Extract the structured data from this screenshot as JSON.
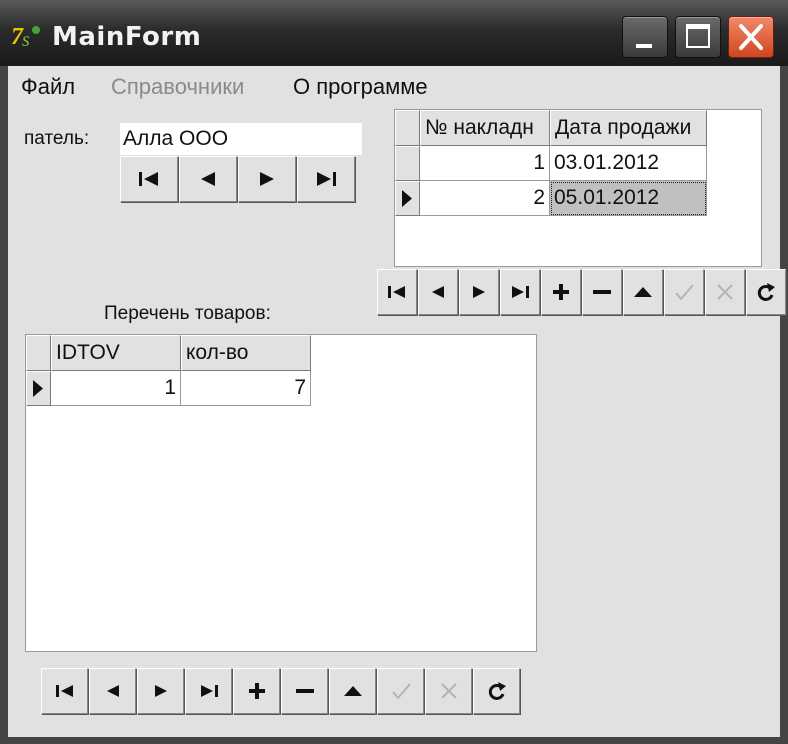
{
  "window": {
    "title": "MainForm",
    "controls": [
      "minimize",
      "maximize",
      "close"
    ]
  },
  "menu": [
    {
      "label": "Файл",
      "enabled": true
    },
    {
      "label": "Справочники",
      "enabled": false
    },
    {
      "label": "О программе",
      "enabled": true
    }
  ],
  "buyer": {
    "label": "патель:",
    "value": "Алла ООО"
  },
  "invoices_grid": {
    "columns": [
      "№ накладн",
      "Дата продажи"
    ],
    "rows": [
      {
        "number": "1",
        "date": "03.01.2012"
      },
      {
        "number": "2",
        "date": "05.01.2012"
      }
    ],
    "current_row": 2
  },
  "goods": {
    "caption": "Перечень товаров:",
    "columns": [
      "IDTOV",
      "кол-во"
    ],
    "rows": [
      {
        "id": "1",
        "qty": "7"
      }
    ]
  },
  "navigator_buttons": [
    "first",
    "prior",
    "next",
    "last",
    "insert",
    "delete",
    "edit",
    "post",
    "cancel",
    "refresh"
  ],
  "disabled_buttons": [
    "post",
    "cancel"
  ],
  "colors": {
    "titlebar": "#2b2b2b",
    "close_button": "#d0451f",
    "client": "#e1e1e1",
    "selected_cell": "#c0c0c0"
  }
}
